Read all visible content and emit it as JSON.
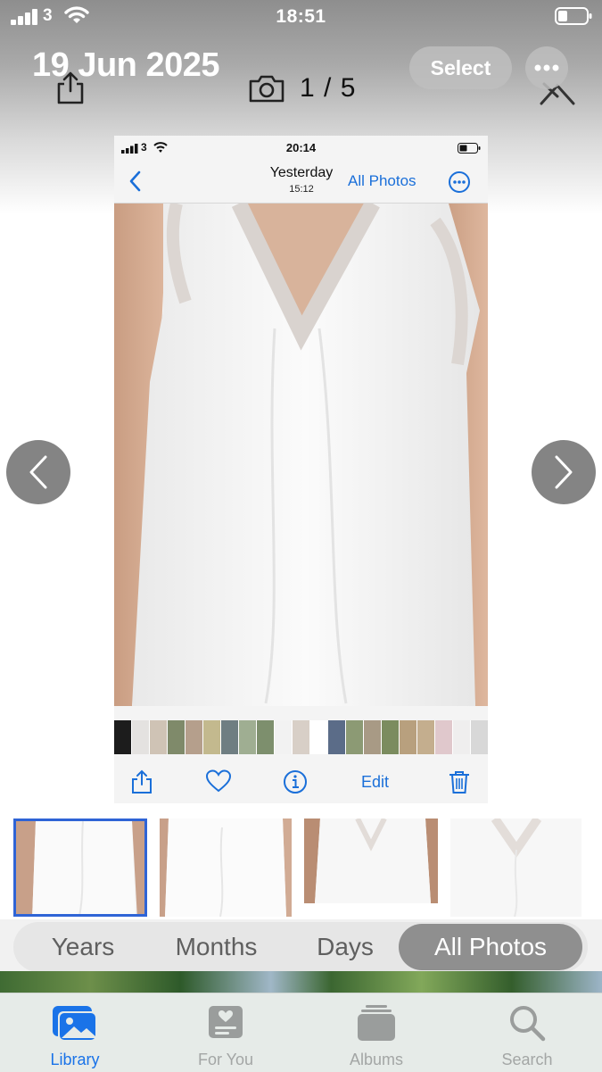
{
  "status_bar": {
    "time": "18:51",
    "carrier": "3"
  },
  "header": {
    "date": "19 Jun 2025",
    "select_label": "Select",
    "counter": "1 / 5"
  },
  "inner_screenshot": {
    "status_time": "20:14",
    "carrier": "3",
    "nav_title": "Yesterday",
    "nav_subtitle": "15:12",
    "all_photos_label": "All Photos",
    "edit_label": "Edit"
  },
  "segments": [
    {
      "label": "Years"
    },
    {
      "label": "Months"
    },
    {
      "label": "Days"
    },
    {
      "label": "All Photos",
      "active": true
    }
  ],
  "tabs": [
    {
      "label": "Library",
      "icon": "photo-library-icon",
      "active": true
    },
    {
      "label": "For You",
      "icon": "for-you-icon"
    },
    {
      "label": "Albums",
      "icon": "albums-icon"
    },
    {
      "label": "Search",
      "icon": "search-icon"
    }
  ],
  "colors": {
    "accent": "#1a73e8",
    "inner_accent": "#1a6fd9",
    "selected_thumb_border": "#2f64d6"
  }
}
